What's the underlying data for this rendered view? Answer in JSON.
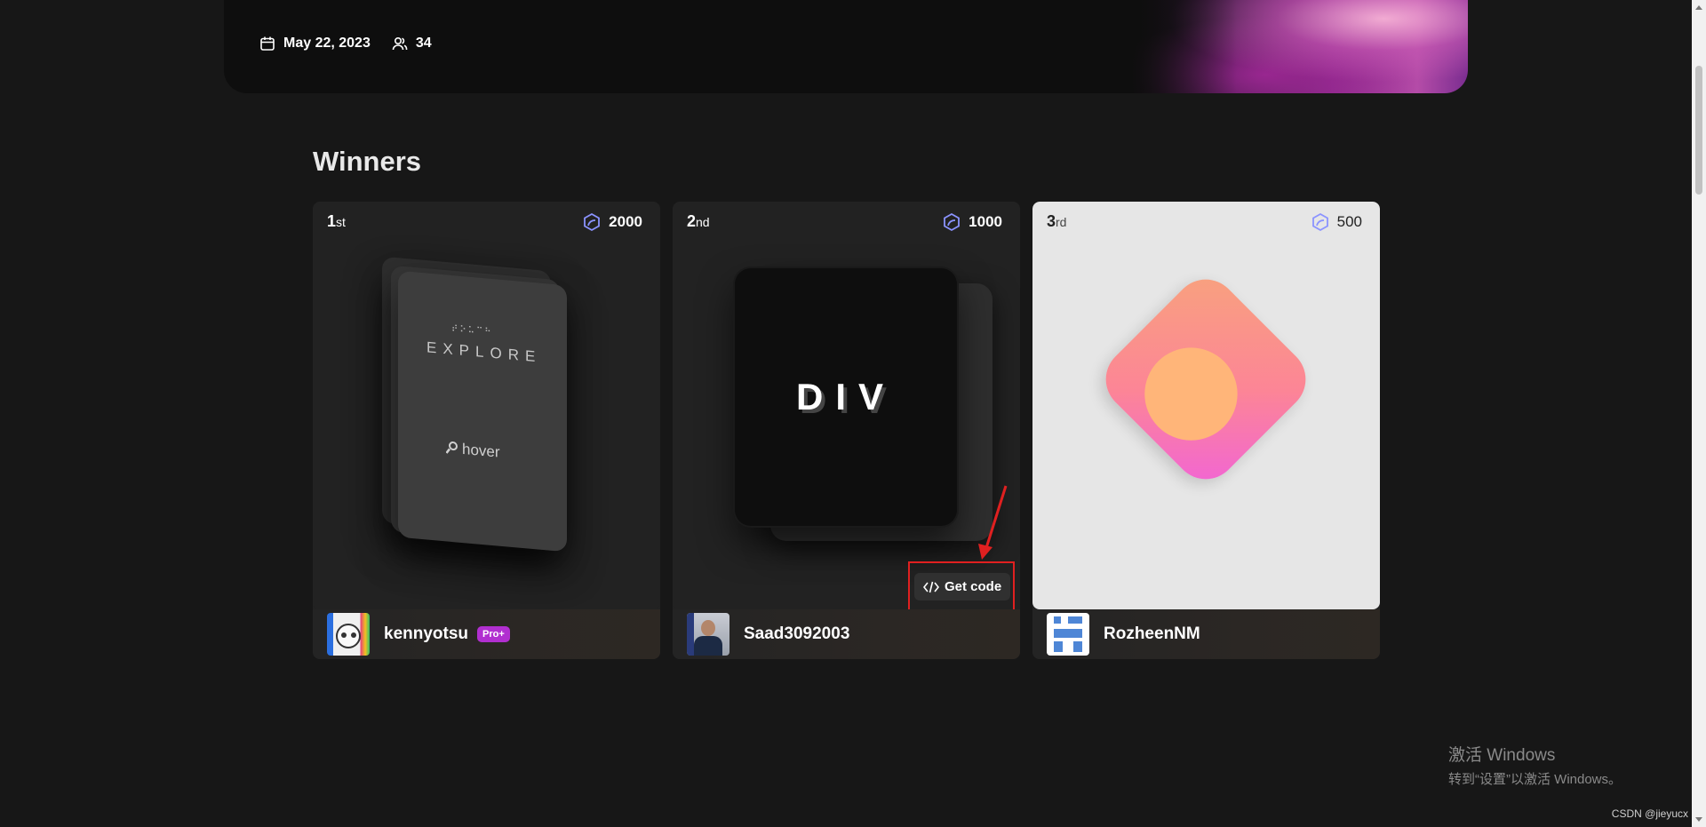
{
  "banner": {
    "date": "May 22, 2023",
    "participants": "34"
  },
  "section": {
    "title": "Winners"
  },
  "winners": [
    {
      "rank_num": "1",
      "rank_suffix": "st",
      "points": "2000",
      "username": "kennyotsu",
      "badge": "Pro+",
      "art": {
        "braille": "⠞⠕⠥⠉⠓",
        "title": "EXPLORE",
        "hint": "hover"
      }
    },
    {
      "rank_num": "2",
      "rank_suffix": "nd",
      "points": "1000",
      "username": "Saad3092003",
      "art": {
        "title": "DIV"
      },
      "get_code_label": "Get code"
    },
    {
      "rank_num": "3",
      "rank_suffix": "rd",
      "points": "500",
      "username": "RozheenNM"
    }
  ],
  "colors": {
    "background": "#171717",
    "card": "#222222",
    "pro_badge": "#b12fd0",
    "highlight": "#e02020",
    "points_icon": "#8b93ff"
  },
  "watermark": {
    "title": "激活 Windows",
    "subtitle": "转到“设置”以激活 Windows。",
    "credit": "CSDN @jieyucx"
  }
}
